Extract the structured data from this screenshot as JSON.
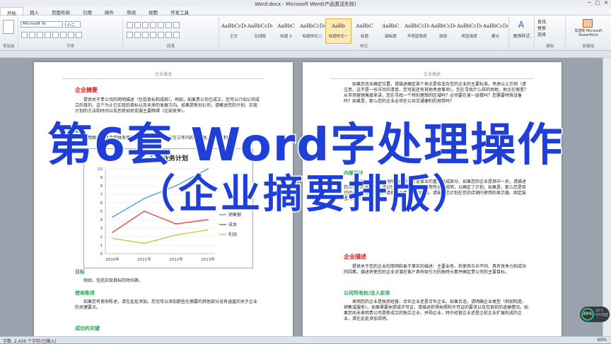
{
  "window": {
    "title": "Word.docx - Microsoft Word(产品激活失败)",
    "controls": [
      "─",
      "□",
      "✕"
    ]
  },
  "menu": [
    "开始",
    "插入",
    "页面布局",
    "引用",
    "邮件",
    "审阅",
    "视图",
    "开发工具"
  ],
  "ribbon": {
    "font_name": "Microsoft Ya",
    "font_size": "小二",
    "groups": [
      "剪贴板",
      "字体",
      "段落",
      "样式",
      "编辑",
      "新建组"
    ],
    "styles": [
      {
        "preview": "AaBbCcDd",
        "name": "正文"
      },
      {
        "preview": "AaBbCcDd",
        "name": "无间隔"
      },
      {
        "preview": "AaBbC",
        "name": "标题 3"
      },
      {
        "preview": "AaBbCcDd",
        "name": "标题样式二"
      },
      {
        "preview": "AaBb",
        "name": "标题样式一"
      },
      {
        "preview": "AaBbC",
        "name": "标题"
      },
      {
        "preview": "AaBbC",
        "name": "副标题"
      },
      {
        "preview": "AaBbCcDd",
        "name": "不明显强调"
      },
      {
        "preview": "AaBbCcDd",
        "name": "强调"
      },
      {
        "preview": "AaBbCcDd",
        "name": "明显强调"
      },
      {
        "preview": "AaBbCcDd",
        "name": "要点"
      }
    ],
    "change_styles": "更改样式",
    "edit": [
      "查找",
      "替换",
      "选择"
    ],
    "send": "发送到 Microsoft PowerPoint"
  },
  "page1": {
    "header": "企业描述",
    "h1": "企业摘要",
    "p1": "提供关于贵公司的简明描述（包括目标和成就）。例如，如果贵公司已成立，您可以介绍公司成立的目的、这个为止已实现的目标以及未来的发展方向。如果是新创公司，请概述您的计划、实现计划的方法和时间以及您将如何克服主要障碍（比如竞争）。",
    "h_key": "重点",
    "p_key": "使用图表来显示您财务摘要中的关键信息，例如在三年内的销售额、成本和利润。",
    "chart_title": "公司业务计划",
    "legend": [
      "销售额",
      "成本",
      "利润"
    ],
    "h_goal": "目标",
    "p_goal": "例如，包括实现目标的时间表。",
    "h_mission": "使命陈述",
    "p_mission": "如果您有使命陈述，请在此处添加。您也可以添加那些在摘要的其他部分没有涵盖的关于企业的关键要点。",
    "h_success": "成功的关键"
  },
  "chart_data": {
    "type": "line",
    "title": "公司业务计划",
    "categories": [
      "2010年",
      "2011年",
      "2012年",
      "2013年"
    ],
    "series": [
      {
        "name": "销售额",
        "values": [
          4.3,
          6.5,
          8,
          10
        ],
        "color": "#4f9fe8"
      },
      {
        "name": "成本",
        "values": [
          2.5,
          5,
          3.5,
          4
        ],
        "color": "#e84848"
      },
      {
        "name": "利润",
        "values": [
          1.8,
          1.2,
          2.2,
          2.8
        ],
        "color": "#b8d04a"
      }
    ],
    "ylim": [
      0,
      10
    ],
    "yticks": [
      0,
      1,
      2,
      3,
      4,
      5,
      6,
      7,
      8,
      9,
      10
    ]
  },
  "page2": {
    "header": "企业描述",
    "p1": "如果您尚未确定位置，请描述确定某个地点是否适合您的企业的主要标准。考虑以上示例（请注意，这不是一份详尽的清单，您可能还有其他考虑事项）。您在寻找什么样的场地，地点在哪里？从市场营销角度来讲，您在寻找一个特别理想的区域吗？必须要在某一层楼吗？您需要特殊设备吗？如果是，那么您的企业必须在公共交通便利的地带吗？",
    "h_design": "内部设计",
    "p_design": "对某些企业来说，场所的内部设计是事业的重要组成部分。如果您的企业是其中一员，请描述您所需的环境类型。请记住，应对所设计的实用性进行说明，以确定了计划，如果是，那么您是否已经有了具体的计划？请描述大概费用和时间。请描述您计划在您的店铺内使用的显示器、固定装置或特殊设备。",
    "h_desc": "企业描述",
    "p_desc": "提供关于您的企业的简明和易于事实的描述：主要业务、和使其与众不同、具有竞争力和成功的因素。描述将使您的企业对潜在客户具有吸引力的独特元素并确定贵公司的主要目标。",
    "h_owner": "公司所有权/法人实体",
    "p_owner": "表明您的企业是独资经营、合伙企业还是合伙企业。如果合适，请明确企业类型（例如制造、销售或服务）。如果需要执照或许可证，请描述获得执照和许可证的要求以及您目前的进展情况。如果您尚未表明贵公司是新成立的独立企业、并购企业、特许经营企业还是之前企业扩展形成的企业，请在此处添加说明。"
  },
  "overlay": {
    "line1": "第6套 Word字处理操作",
    "line2": "（企业摘要排版）"
  },
  "status": {
    "words": "字数: 2,426 个字符(已输入)",
    "zoom": "60%"
  },
  "perf": {
    "cpu": "49%",
    "temp": "30°C",
    "cpu_label": "CPU温度"
  }
}
